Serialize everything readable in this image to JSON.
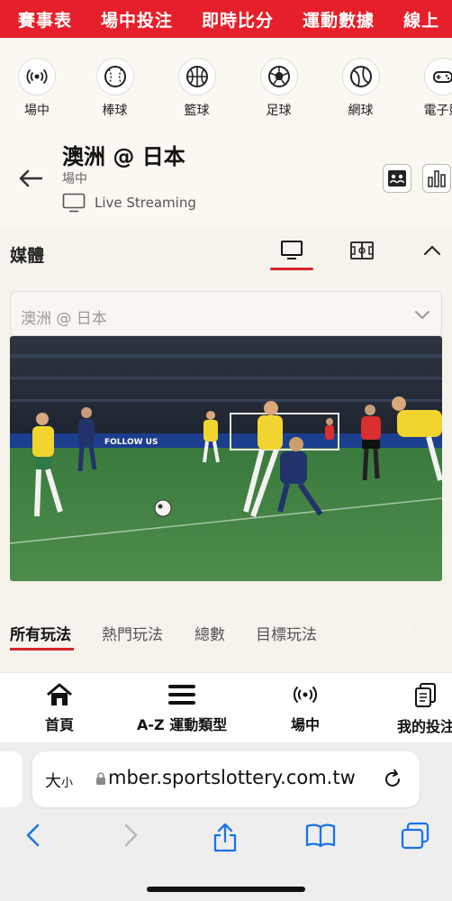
{
  "top_nav": [
    "賽事表",
    "場中投注",
    "即時比分",
    "運動數據",
    "線上"
  ],
  "sports": [
    {
      "label": "場中",
      "icon": "live-broadcast-icon"
    },
    {
      "label": "棒球",
      "icon": "baseball-icon"
    },
    {
      "label": "籃球",
      "icon": "basketball-icon"
    },
    {
      "label": "足球",
      "icon": "soccer-ball-icon"
    },
    {
      "label": "網球",
      "icon": "tennis-ball-icon"
    },
    {
      "label": "電子競",
      "icon": "esports-icon"
    }
  ],
  "match": {
    "title": "澳洲 @ 日本",
    "subtitle": "場中",
    "live_label": "Live Streaming"
  },
  "media": {
    "label": "媒體",
    "selected_tab": "tv",
    "select_value": "澳洲 @ 日本"
  },
  "video": {
    "banner_text": "FOLLOW US"
  },
  "play_tabs": [
    {
      "label": "所有玩法",
      "active": true
    },
    {
      "label": "熱門玩法",
      "active": false
    },
    {
      "label": "總數",
      "active": false
    },
    {
      "label": "目標玩法",
      "active": false
    }
  ],
  "bottom_nav": [
    {
      "label": "首頁",
      "icon": "home-icon"
    },
    {
      "label": "A-Z 運動類型",
      "icon": "menu-icon"
    },
    {
      "label": "場中",
      "icon": "live-broadcast-icon"
    },
    {
      "label": "我的投注",
      "icon": "copy-icon"
    }
  ],
  "browser": {
    "text_size": "大",
    "text_size_small": "小",
    "url": "mber.sportslottery.com.tw"
  },
  "colors": {
    "brand_red": "#e5202b",
    "accent_underline": "#d8222b",
    "ios_blue": "#1a73e8"
  }
}
